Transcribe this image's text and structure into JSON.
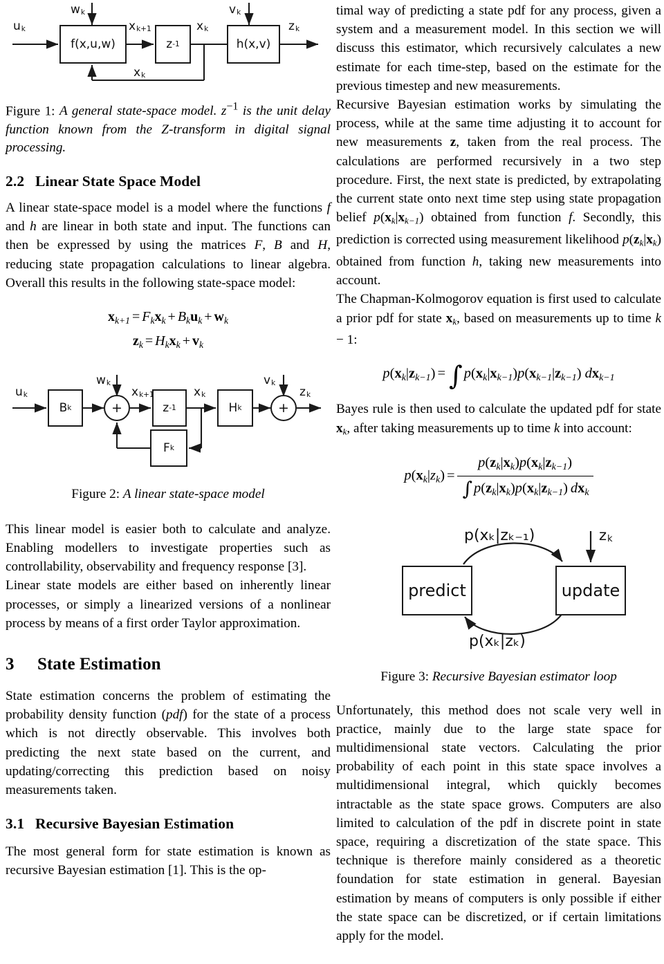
{
  "document": {
    "type": "academic-paper-two-column"
  },
  "left_column": {
    "figure1": {
      "name": "general-state-space-model",
      "blocks": [
        {
          "id": "f",
          "label": "f(x,u,w)"
        },
        {
          "id": "z",
          "label": "z",
          "exponent": "-1"
        },
        {
          "id": "h",
          "label": "h(x,v)"
        }
      ],
      "signals": {
        "u": "u",
        "u_sub": "k",
        "w": "w",
        "w_sub": "k",
        "v": "v",
        "v_sub": "k",
        "z_out": "z",
        "z_out_sub": "k",
        "x_next": "x",
        "x_next_sub": "k+1",
        "x_state": "x",
        "x_state_sub": "k",
        "x_feedback": "x",
        "x_feedback_sub": "k"
      },
      "caption_num": "Figure 1: ",
      "caption_text": "A general state-space model. z−1 is the unit delay function known from the Z-transform in digital signal processing."
    },
    "section_2_2": {
      "number": "2.2",
      "title": "Linear State Space Model",
      "paragraph": "A linear state-space model is a model where the functions f and h are linear in both state and input. The functions can then be expressed by using the matrices F, B and H, reducing state propagation calculations to linear algebra. Overall this results in the following state-space model:"
    },
    "equation_state_space": {
      "line1": "xₖ₊₁ = Fₖxₖ + Bₖuₖ + wₖ",
      "line2": "zₖ = Hₖxₖ + vₖ"
    },
    "figure2": {
      "name": "linear-state-space-model",
      "blocks": [
        {
          "id": "B",
          "label": "B",
          "sub": "k"
        },
        {
          "id": "z",
          "label": "z",
          "exponent": "-1"
        },
        {
          "id": "F",
          "label": "F",
          "sub": "k"
        },
        {
          "id": "H",
          "label": "H",
          "sub": "k"
        }
      ],
      "summers": [
        "+",
        "+"
      ],
      "signals": {
        "u": "u",
        "u_sub": "k",
        "w": "w",
        "w_sub": "k",
        "v": "v",
        "v_sub": "k",
        "z_out": "z",
        "z_out_sub": "k",
        "x_next": "x",
        "x_next_sub": "k+1",
        "x_state": "x",
        "x_state_sub": "k"
      },
      "caption_num": "Figure 2: ",
      "caption_text": "A linear state-space model"
    },
    "paragraph_linear_model": "This linear model is easier both to calculate and analyze. Enabling modellers to investigate properties such as controllability, observability and frequency response [3].",
    "paragraph_linear_state_models": "Linear state models are either based on inherently linear processes, or simply a linearized versions of a nonlinear process by means of a first order Taylor approximation.",
    "section_3": {
      "number": "3",
      "title": "State Estimation",
      "paragraph": "State estimation concerns the problem of estimating the probability density function (pdf) for the state of a process which is not directly observable. This involves both predicting the next state based on the current, and updating/correcting this prediction based on noisy measurements taken."
    },
    "section_3_1": {
      "number": "3.1",
      "title": "Recursive Bayesian Estimation",
      "paragraph": "The most general form for state estimation is known as recursive Bayesian estimation [1]. This is the op-"
    }
  },
  "right_column": {
    "paragraph_optimal": "timal way of predicting a state pdf for any process, given a system and a measurement model. In this section we will discuss this estimator, which recursively calculates a new estimate for each time-step, based on the estimate for the previous timestep and new measurements.",
    "paragraph_recursive": "Recursive Bayesian estimation works by simulating the process, while at the same time adjusting it to account for new measurements z, taken from the real process. The calculations are performed recursively in a two step procedure. First, the next state is predicted, by extrapolating the current state onto next time step using state propagation belief p(xₖ|xₖ₋₁) obtained from function f. Secondly, this prediction is corrected using measurement likelihood p(zₖ|xₖ) obtained from function h, taking new measurements into account.",
    "paragraph_chapman": "The Chapman-Kolmogorov equation is first used to calculate a prior pdf for state xₖ, based on measurements up to time k − 1:",
    "equation_chapman": "p(xₖ|zₖ₋₁) = ∫ p(xₖ|xₖ₋₁)p(xₖ₋₁|zₖ₋₁) dxₖ₋₁",
    "paragraph_bayes": "Bayes rule is then used to calculate the updated pdf for state xₖ, after taking measurements up to time k into account:",
    "equation_bayes": "p(xₖ|zₖ) = p(zₖ|xₖ)p(xₖ|zₖ₋₁) / ∫ p(zₖ|xₖ)p(xₖ|zₖ₋₁) dxₖ",
    "figure3": {
      "name": "recursive-bayesian-estimator-loop",
      "box_predict": "predict",
      "box_update": "update",
      "label_top": "p(xₖ|zₖ₋₁)",
      "label_bottom": "p(xₖ|zₖ)",
      "label_input": "z",
      "label_input_sub": "k",
      "caption_num": "Figure 3: ",
      "caption_text": "Recursive Bayesian estimator loop"
    },
    "paragraph_unfortunately": "Unfortunately, this method does not scale very well in practice, mainly due to the large state space for multidimensional state vectors. Calculating the prior probability of each point in this state space involves a multidimensional integral, which quickly becomes intractable as the state space grows. Computers are also limited to calculation of the pdf in discrete point in state space, requiring a discretization of the state space. This technique is therefore mainly considered as a theoretic foundation for state estimation in general. Bayesian estimation by means of computers is only possible if either the state space can be discretized, or if certain limitations apply for the model."
  }
}
